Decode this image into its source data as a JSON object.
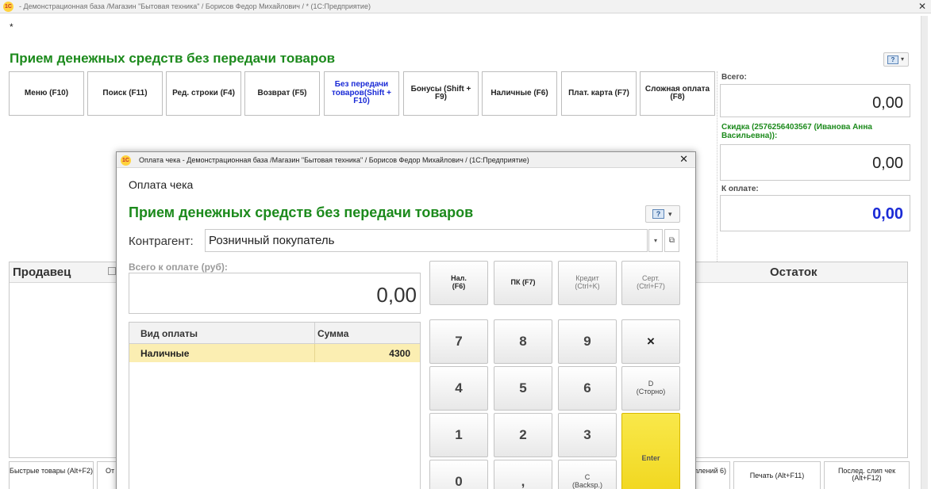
{
  "main_window": {
    "title": "- Демонстрационная база /Магазин \"Бытовая техника\" / Борисов Федор Михайлович / * (1С:Предприятие)",
    "modified_mark": "*",
    "heading": "Прием денежных средств без передачи товаров",
    "logo_text": "1С",
    "close_glyph": "✕",
    "help_glyph": "?",
    "dropdown_glyph": "▾",
    "toolbar": [
      {
        "label": "Меню (F10)"
      },
      {
        "label": "Поиск (F11)"
      },
      {
        "label": "Ред. строки (F4)"
      },
      {
        "label": "Возврат (F5)"
      },
      {
        "label": "Без передачи товаров(Shift + F10)"
      },
      {
        "label": "Бонусы (Shift + F9)"
      },
      {
        "label": "Наличные (F6)"
      },
      {
        "label": "Плат. карта (F7)"
      },
      {
        "label": "Сложная оплата (F8)"
      }
    ],
    "totals": {
      "total_label": "Всего:",
      "total_value": "0,00",
      "discount_label": "Скидка (2576256403567 (Иванова Анна Васильевна)):",
      "discount_value": "0,00",
      "to_pay_label": "К оплате:",
      "to_pay_value": "0,00"
    },
    "table_headers": {
      "seller": "Продавец",
      "remaining": "Остаток"
    },
    "bottom_buttons": [
      {
        "label": "Быстрые товары (Alt+F2)"
      },
      {
        "label": "От"
      },
      {
        "label": "оплений 6)"
      },
      {
        "label": "Печать (Alt+F11)"
      },
      {
        "label": "Послед. слип чек (Alt+F12)"
      }
    ]
  },
  "dialog": {
    "title": "Оплата чека - Демонстрационная база /Магазин \"Бытовая техника\" / Борисов Федор Михайлович / (1С:Предприятие)",
    "subtitle": "Оплата чека",
    "heading": "Прием денежных средств без передачи товаров",
    "counterparty_label": "Контрагент:",
    "counterparty_value": "Розничный покупатель",
    "open_glyph": "⧉",
    "total_label": "Всего к оплате (руб):",
    "total_value": "0,00",
    "payments": {
      "columns": [
        "Вид оплаты",
        "Сумма"
      ],
      "rows": [
        {
          "type": "Наличные",
          "amount": "4300"
        }
      ]
    },
    "keypad": {
      "cash": [
        "Нал.",
        "(F6)"
      ],
      "card": "ПК (F7)",
      "credit": [
        "Кредит",
        "(Ctrl+K)"
      ],
      "cert": [
        "Серт.",
        "(Ctrl+F7)"
      ],
      "seven": "7",
      "eight": "8",
      "nine": "9",
      "multiply": "×",
      "four": "4",
      "five": "5",
      "six": "6",
      "storno": [
        "D",
        "(Сторно)"
      ],
      "one": "1",
      "two": "2",
      "three": "3",
      "enter": "Enter",
      "zero": "0",
      "comma": ",",
      "backspace": [
        "C",
        "(Backsp.)"
      ]
    }
  }
}
